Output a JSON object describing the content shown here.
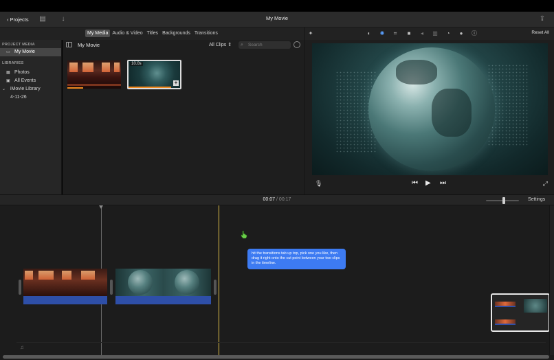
{
  "titlebar": {
    "projects_label": "Projects",
    "movie_title": "My Movie",
    "icons": [
      "chevron-left-icon",
      "browser-layout-icon",
      "import-arrow-icon",
      "share-icon"
    ]
  },
  "browser_tabs": [
    {
      "label": "My Media",
      "active": true
    },
    {
      "label": "Audio & Video",
      "active": false
    },
    {
      "label": "Titles",
      "active": false
    },
    {
      "label": "Backgrounds",
      "active": false
    },
    {
      "label": "Transitions",
      "active": false
    }
  ],
  "sidebar": {
    "project_media_header": "PROJECT MEDIA",
    "project_item": "My Movie",
    "libraries_header": "LIBRARIES",
    "photos": "Photos",
    "all_events": "All Events",
    "library": "iMovie Library",
    "event": "4-11-26"
  },
  "media": {
    "title": "My Movie",
    "filter": "All Clips",
    "search_placeholder": "Search",
    "clips": [
      {
        "name": "sunset-street-clip",
        "duration": ""
      },
      {
        "name": "globe-clip",
        "duration": "10.0s"
      }
    ]
  },
  "viewer": {
    "reset_label": "Reset All",
    "tools": [
      "magic-wand-icon",
      "color-balance-icon",
      "color-correction-icon",
      "crop-icon",
      "stabilization-icon",
      "volume-icon",
      "noise-reduction-icon",
      "speed-icon",
      "clip-filter-icon",
      "info-icon"
    ]
  },
  "timeline": {
    "current_time": "00:07",
    "separator": "/",
    "total_time": "00:17",
    "settings_label": "Settings"
  },
  "tooltip": {
    "text": "hit the transitions tab up top, pick one you like, then drag it right onto the cut point between your two clips in the timeline."
  },
  "colors": {
    "accent_blue": "#3d7bf2",
    "audio_track": "#2e4fa8",
    "playhead": "#e3c24a",
    "clip_progress": "#f08a20"
  }
}
